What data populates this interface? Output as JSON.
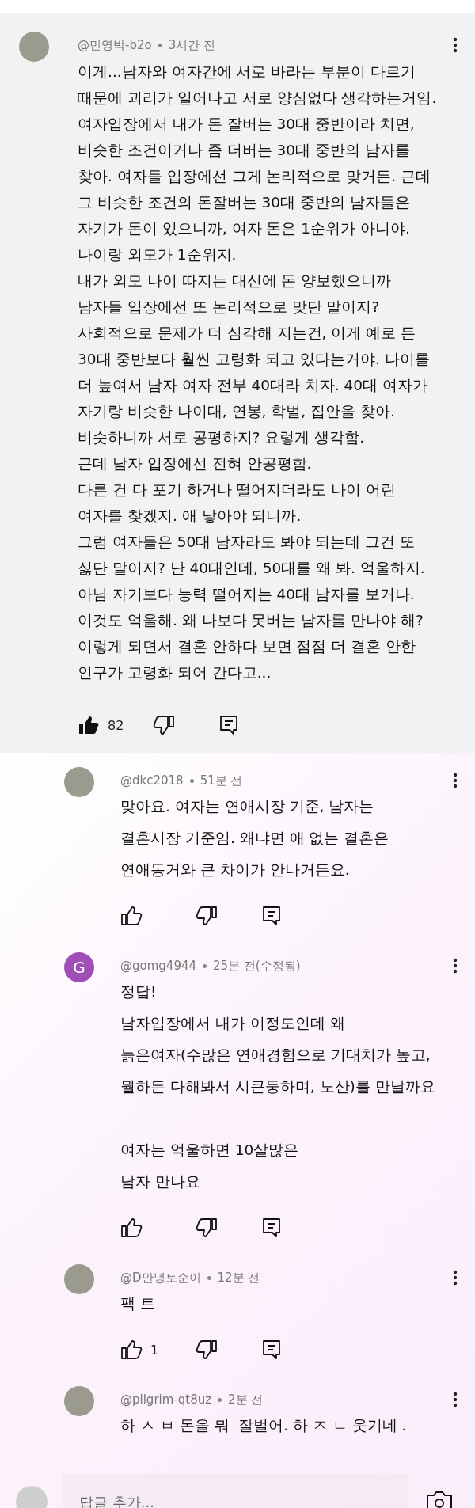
{
  "comment": {
    "author": "@민영박-b2o",
    "time": "3시간 전",
    "avatar": {
      "kind": "photo"
    },
    "text": "이게...남자와 여자간에 서로 바라는 부분이 다르기\n때문에 괴리가 일어나고 서로 양심없다 생각하는거임.\n여자입장에서 내가 돈 잘버는 30대 중반이라 치면,\n비슷한 조건이거나 좀 더버는 30대 중반의 남자를\n찾아. 여자들 입장에선 그게 논리적으로 맞거든. 근데\n그 비슷한 조건의 돈잘버는 30대 중반의 남자들은\n자기가 돈이 있으니까, 여자 돈은 1순위가 아니야.\n나이랑 외모가 1순위지.\n내가 외모 나이 따지는 대신에 돈 양보했으니까\n남자들 입장에선 또 논리적으로 맞단 말이지?\n사회적으로 문제가 더 심각해 지는건, 이게 예로 든\n30대 중반보다 훨씬 고령화 되고 있다는거야. 나이를\n더 높여서 남자 여자 전부 40대라 치자. 40대 여자가\n자기랑 비슷한 나이대, 연봉, 학벌, 집안을 찾아.\n비슷하니까 서로 공평하지? 요렇게 생각함.\n근데 남자 입장에선 전혀 안공평함.\n다른 건 다 포기 하거나 떨어지더라도 나이 어린\n여자를 찾겠지. 애 낳아야 되니까.\n그럼 여자들은 50대 남자라도 봐야 되는데 그건 또\n싫단 말이지? 난 40대인데, 50대를 왜 봐. 억울하지.\n아님 자기보다 능력 떨어지는 40대 남자를 보거나.\n이것도 억울해. 왜 나보다 못버는 남자를 만나야 해?\n이렇게 되면서 결혼 안하다 보면 점점 더 결혼 안한\n인구가 고령화 되어 간다고...",
    "likes": "82",
    "liked": true
  },
  "replies": [
    {
      "author": "@dkc2018",
      "time": "51분 전",
      "avatar": {
        "kind": "photo"
      },
      "text": "맞아요. 여자는 연애시장 기준, 남자는\n결혼시장 기준임. 왜냐면 애 없는 결혼은\n연애동거와 큰 차이가 안나거든요.",
      "liked": false
    },
    {
      "author": "@gomg4944",
      "time": "25분 전(수정됨)",
      "avatar": {
        "kind": "letter",
        "letter": "G",
        "color": "#a04fb8"
      },
      "text": "정답!\n남자입장에서 내가 이정도인데 왜\n늙은여자(수많은 연애경험으로 기대치가 높고,\n뭘하든 다해봐서 시큰둥하며, 노산)를 만날까요\n\n여자는 억울하면 10살많은\n남자 만나요",
      "liked": false
    },
    {
      "author": "@D안녕토순이",
      "time": "12분 전",
      "avatar": {
        "kind": "photo"
      },
      "text": "팩 트",
      "likes": "1",
      "liked": false
    },
    {
      "author": "@pilgrim-qt8uz",
      "time": "2분 전",
      "avatar": {
        "kind": "photo"
      },
      "text": "하 ㅅ ㅂ 돈을 뭐  잘벌어. 하 ㅈ ㄴ 웃기네 .",
      "actions": false
    }
  ],
  "reply_box": {
    "placeholder": "답글 추가..."
  }
}
